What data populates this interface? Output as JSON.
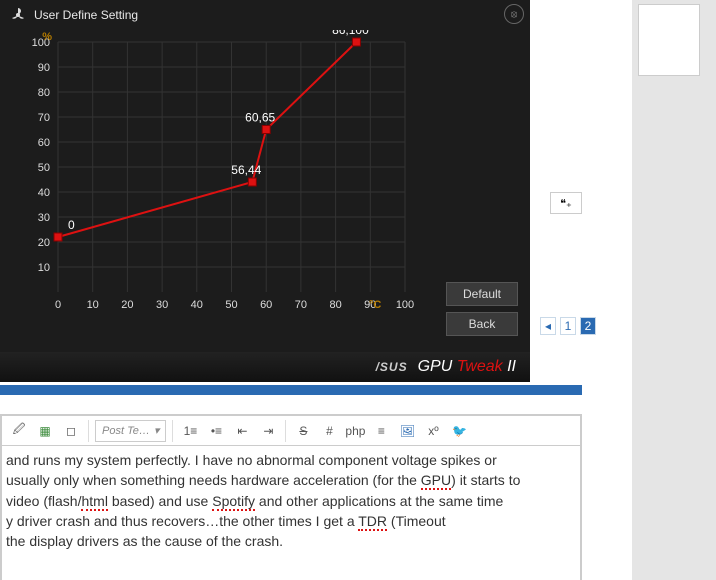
{
  "gpu": {
    "title": "User Define Setting",
    "close_label": "✕",
    "buttons": {
      "default": "Default",
      "back": "Back"
    },
    "brand_asus": "/SUS",
    "brand_name_pre": "GPU ",
    "brand_name_red": "Tweak",
    "brand_name_post": " II"
  },
  "chart_data": {
    "type": "line",
    "xlabel": "°C",
    "ylabel": "%",
    "xlim": [
      0,
      100
    ],
    "ylim": [
      0,
      100
    ],
    "x_ticks": [
      0,
      10,
      20,
      30,
      40,
      50,
      60,
      70,
      80,
      90,
      100
    ],
    "y_ticks": [
      10,
      20,
      30,
      40,
      50,
      60,
      70,
      80,
      90,
      100
    ],
    "points": [
      {
        "x": 0,
        "y": 22,
        "show_label": true,
        "label": "0"
      },
      {
        "x": 56,
        "y": 44,
        "show_label": true,
        "label": "56,44"
      },
      {
        "x": 60,
        "y": 65,
        "show_label": true,
        "label": "60,65"
      },
      {
        "x": 86,
        "y": 100,
        "show_label": true,
        "label": "86,100"
      }
    ]
  },
  "forum": {
    "quote_icon": "❝₊",
    "pager": {
      "arrow": "◂",
      "pages": [
        "1",
        "2"
      ],
      "current": "2"
    }
  },
  "editor": {
    "placeholder": "Post Te…",
    "icons": {
      "clip": "🖉",
      "cal": "▦",
      "chat": "◻",
      "ol": "≡",
      "ul": "≡",
      "out": "⇤",
      "in": "⇥",
      "strike": "S",
      "hash": "#",
      "code": "⌘",
      "line": "≡",
      "pic": "🖼",
      "sup": "xº",
      "tw": "🐦"
    }
  },
  "post": {
    "line1_a": "and runs my system perfectly. I have no abnormal component voltage spikes or",
    "line2_a": " usually only when something needs hardware acceleration (for the ",
    "line2_gpu": "GPU",
    "line2_b": ") it starts to",
    "line3_a": " video (flash/",
    "line3_html": "html",
    "line3_b": " based) and use ",
    "line3_sp": "Spotify",
    "line3_c": " and other applications at the same time",
    "line4_a": "y driver crash and thus recovers…the other times I get a ",
    "line4_tdr": "TDR",
    "line4_b": " (Timeout",
    "line5": " the display drivers as the cause of the crash."
  }
}
